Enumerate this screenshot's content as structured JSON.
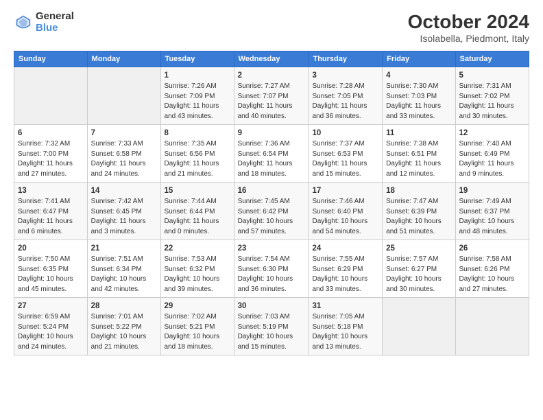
{
  "header": {
    "logo_line1": "General",
    "logo_line2": "Blue",
    "title": "October 2024",
    "subtitle": "Isolabella, Piedmont, Italy"
  },
  "days_of_week": [
    "Sunday",
    "Monday",
    "Tuesday",
    "Wednesday",
    "Thursday",
    "Friday",
    "Saturday"
  ],
  "weeks": [
    [
      {
        "day": "",
        "info": ""
      },
      {
        "day": "",
        "info": ""
      },
      {
        "day": "1",
        "info": "Sunrise: 7:26 AM\nSunset: 7:09 PM\nDaylight: 11 hours and 43 minutes."
      },
      {
        "day": "2",
        "info": "Sunrise: 7:27 AM\nSunset: 7:07 PM\nDaylight: 11 hours and 40 minutes."
      },
      {
        "day": "3",
        "info": "Sunrise: 7:28 AM\nSunset: 7:05 PM\nDaylight: 11 hours and 36 minutes."
      },
      {
        "day": "4",
        "info": "Sunrise: 7:30 AM\nSunset: 7:03 PM\nDaylight: 11 hours and 33 minutes."
      },
      {
        "day": "5",
        "info": "Sunrise: 7:31 AM\nSunset: 7:02 PM\nDaylight: 11 hours and 30 minutes."
      }
    ],
    [
      {
        "day": "6",
        "info": "Sunrise: 7:32 AM\nSunset: 7:00 PM\nDaylight: 11 hours and 27 minutes."
      },
      {
        "day": "7",
        "info": "Sunrise: 7:33 AM\nSunset: 6:58 PM\nDaylight: 11 hours and 24 minutes."
      },
      {
        "day": "8",
        "info": "Sunrise: 7:35 AM\nSunset: 6:56 PM\nDaylight: 11 hours and 21 minutes."
      },
      {
        "day": "9",
        "info": "Sunrise: 7:36 AM\nSunset: 6:54 PM\nDaylight: 11 hours and 18 minutes."
      },
      {
        "day": "10",
        "info": "Sunrise: 7:37 AM\nSunset: 6:53 PM\nDaylight: 11 hours and 15 minutes."
      },
      {
        "day": "11",
        "info": "Sunrise: 7:38 AM\nSunset: 6:51 PM\nDaylight: 11 hours and 12 minutes."
      },
      {
        "day": "12",
        "info": "Sunrise: 7:40 AM\nSunset: 6:49 PM\nDaylight: 11 hours and 9 minutes."
      }
    ],
    [
      {
        "day": "13",
        "info": "Sunrise: 7:41 AM\nSunset: 6:47 PM\nDaylight: 11 hours and 6 minutes."
      },
      {
        "day": "14",
        "info": "Sunrise: 7:42 AM\nSunset: 6:45 PM\nDaylight: 11 hours and 3 minutes."
      },
      {
        "day": "15",
        "info": "Sunrise: 7:44 AM\nSunset: 6:44 PM\nDaylight: 11 hours and 0 minutes."
      },
      {
        "day": "16",
        "info": "Sunrise: 7:45 AM\nSunset: 6:42 PM\nDaylight: 10 hours and 57 minutes."
      },
      {
        "day": "17",
        "info": "Sunrise: 7:46 AM\nSunset: 6:40 PM\nDaylight: 10 hours and 54 minutes."
      },
      {
        "day": "18",
        "info": "Sunrise: 7:47 AM\nSunset: 6:39 PM\nDaylight: 10 hours and 51 minutes."
      },
      {
        "day": "19",
        "info": "Sunrise: 7:49 AM\nSunset: 6:37 PM\nDaylight: 10 hours and 48 minutes."
      }
    ],
    [
      {
        "day": "20",
        "info": "Sunrise: 7:50 AM\nSunset: 6:35 PM\nDaylight: 10 hours and 45 minutes."
      },
      {
        "day": "21",
        "info": "Sunrise: 7:51 AM\nSunset: 6:34 PM\nDaylight: 10 hours and 42 minutes."
      },
      {
        "day": "22",
        "info": "Sunrise: 7:53 AM\nSunset: 6:32 PM\nDaylight: 10 hours and 39 minutes."
      },
      {
        "day": "23",
        "info": "Sunrise: 7:54 AM\nSunset: 6:30 PM\nDaylight: 10 hours and 36 minutes."
      },
      {
        "day": "24",
        "info": "Sunrise: 7:55 AM\nSunset: 6:29 PM\nDaylight: 10 hours and 33 minutes."
      },
      {
        "day": "25",
        "info": "Sunrise: 7:57 AM\nSunset: 6:27 PM\nDaylight: 10 hours and 30 minutes."
      },
      {
        "day": "26",
        "info": "Sunrise: 7:58 AM\nSunset: 6:26 PM\nDaylight: 10 hours and 27 minutes."
      }
    ],
    [
      {
        "day": "27",
        "info": "Sunrise: 6:59 AM\nSunset: 5:24 PM\nDaylight: 10 hours and 24 minutes."
      },
      {
        "day": "28",
        "info": "Sunrise: 7:01 AM\nSunset: 5:22 PM\nDaylight: 10 hours and 21 minutes."
      },
      {
        "day": "29",
        "info": "Sunrise: 7:02 AM\nSunset: 5:21 PM\nDaylight: 10 hours and 18 minutes."
      },
      {
        "day": "30",
        "info": "Sunrise: 7:03 AM\nSunset: 5:19 PM\nDaylight: 10 hours and 15 minutes."
      },
      {
        "day": "31",
        "info": "Sunrise: 7:05 AM\nSunset: 5:18 PM\nDaylight: 10 hours and 13 minutes."
      },
      {
        "day": "",
        "info": ""
      },
      {
        "day": "",
        "info": ""
      }
    ]
  ]
}
